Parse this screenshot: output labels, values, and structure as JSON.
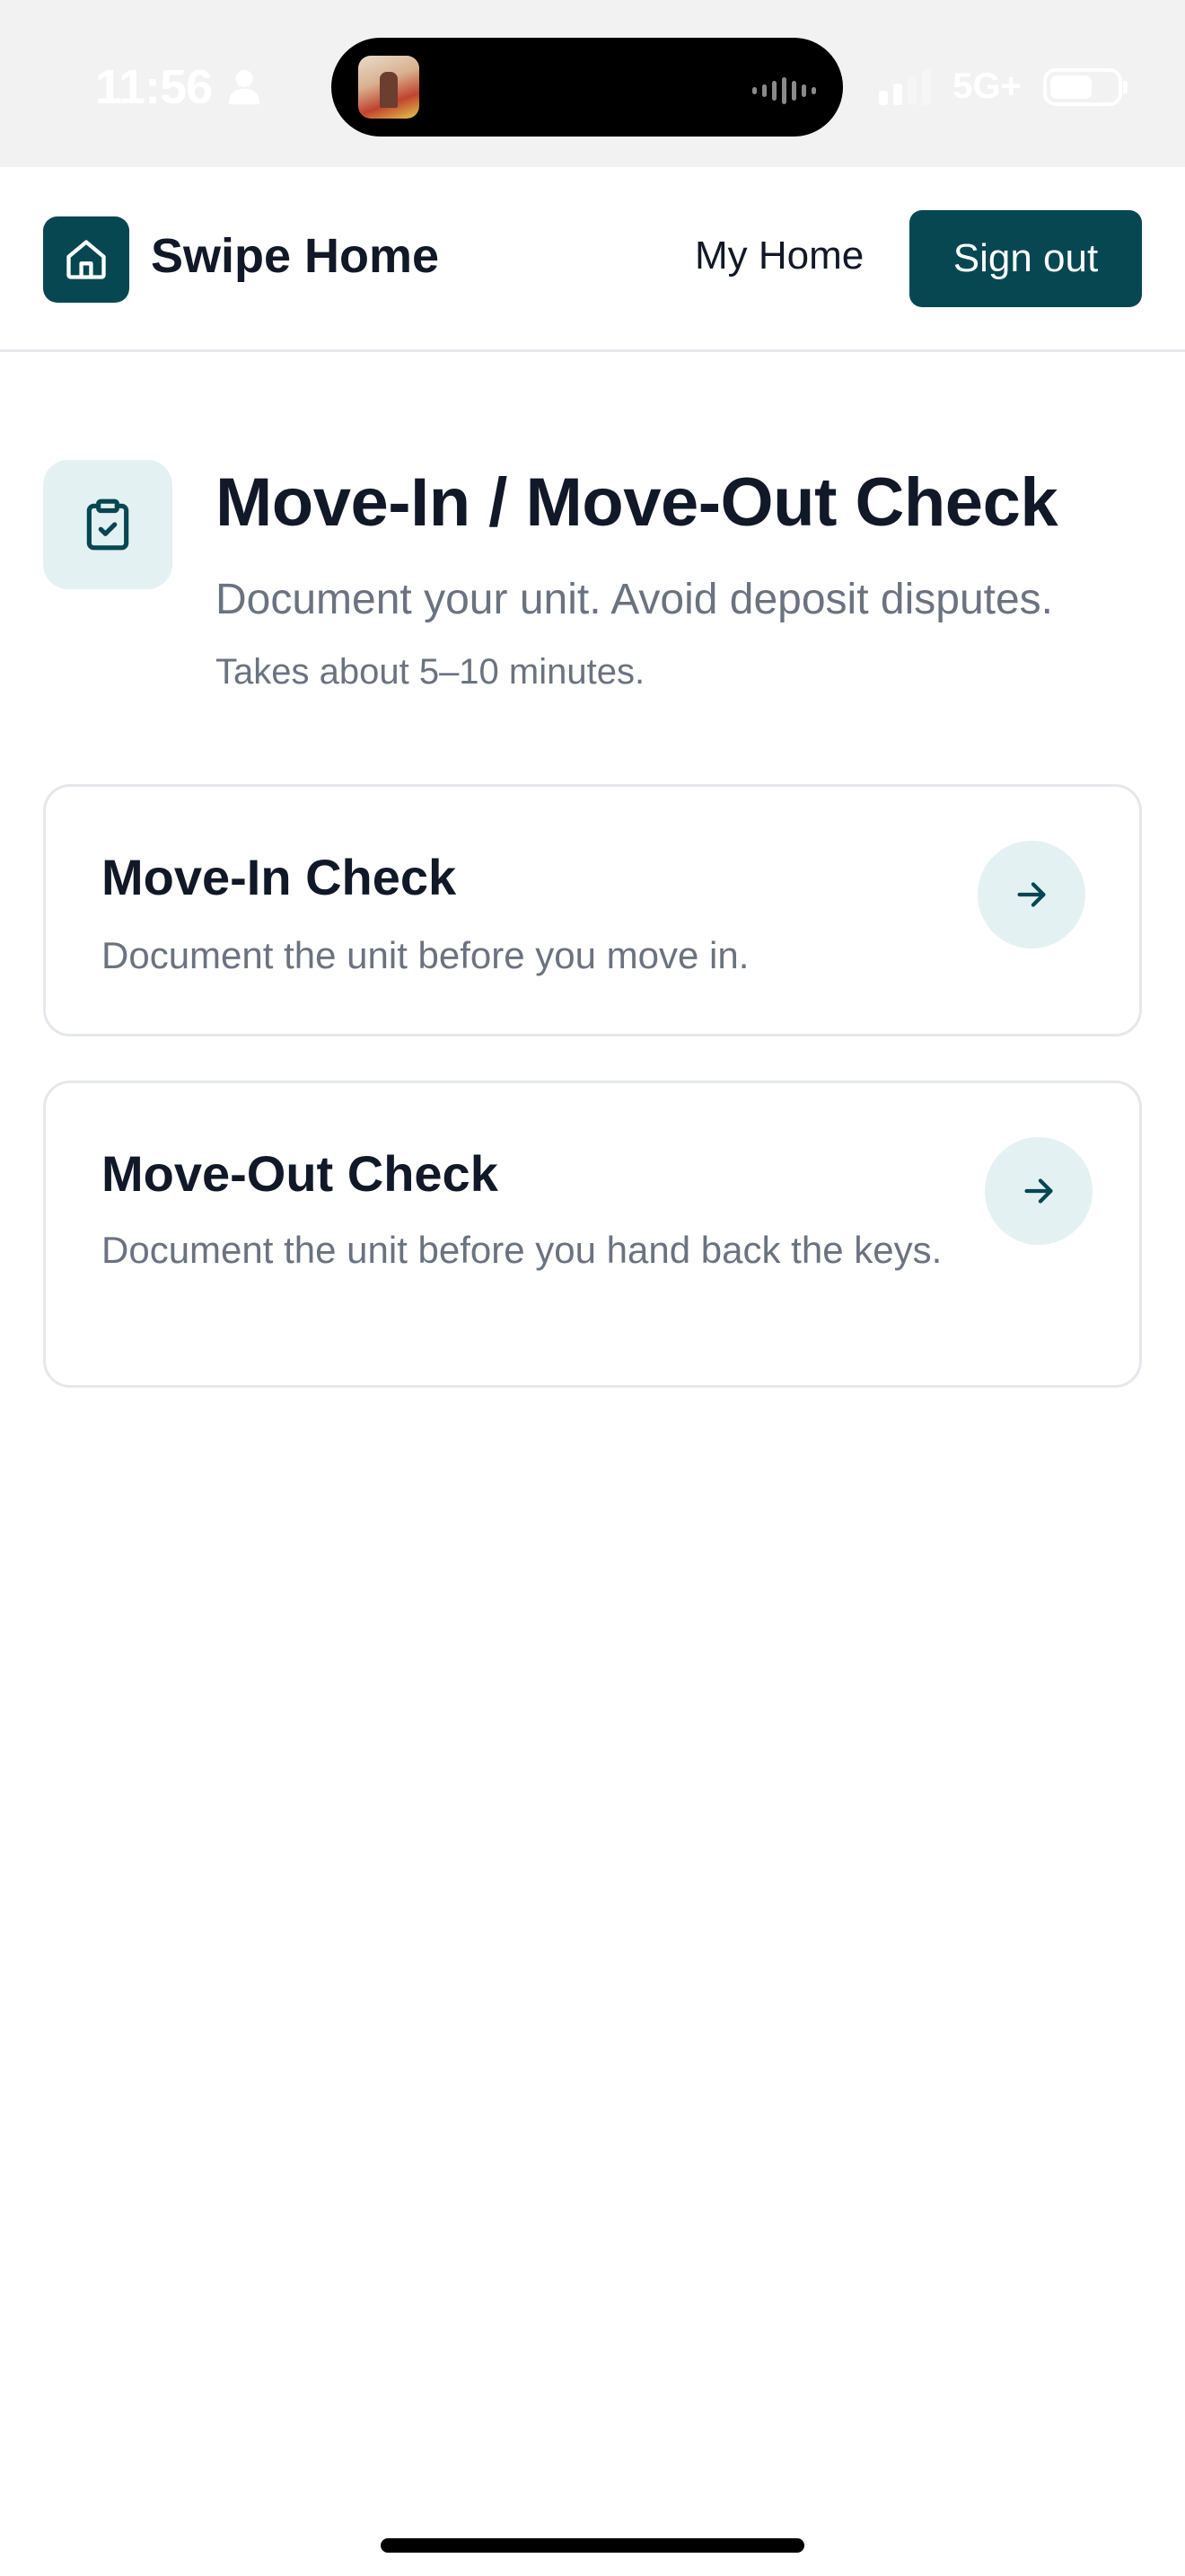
{
  "status_bar": {
    "time": "11:56",
    "network": "5G+",
    "icons": [
      "person-icon",
      "signal-icon",
      "battery-icon"
    ]
  },
  "header": {
    "brand": "Swipe Home",
    "nav_link": "My Home",
    "sign_out": "Sign out",
    "logo_icon": "house-icon",
    "accent_color": "#064752"
  },
  "page": {
    "icon": "clipboard-check-icon",
    "title": "Move-In / Move-Out Check",
    "subtitle": "Document your unit. Avoid deposit disputes.",
    "note": "Takes about 5–10 minutes."
  },
  "cards": [
    {
      "title": "Move-In Check",
      "description": "Document the unit before you move in.",
      "icon": "arrow-right-icon"
    },
    {
      "title": "Move-Out Check",
      "description": "Document the unit before you hand back the keys.",
      "icon": "arrow-right-icon"
    }
  ]
}
